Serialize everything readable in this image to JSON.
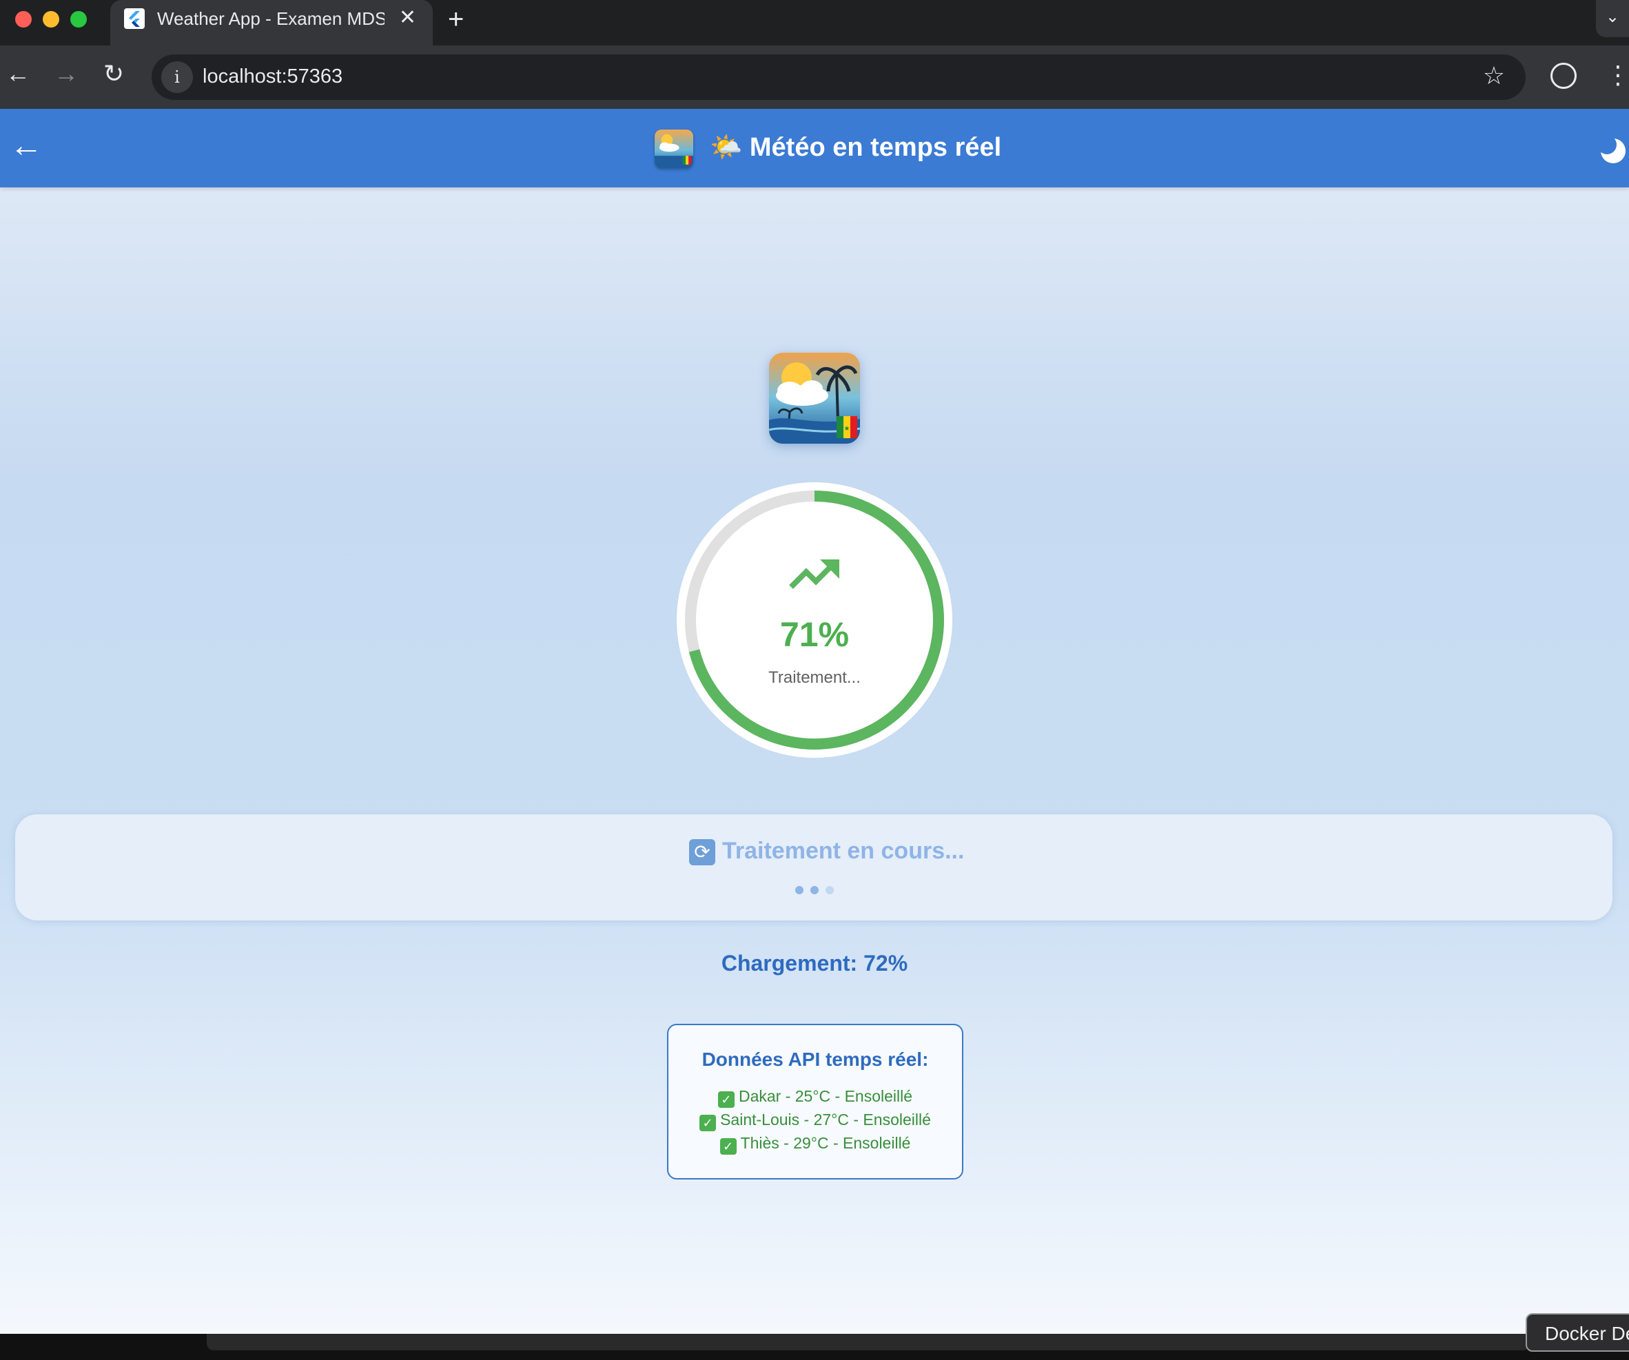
{
  "browser": {
    "tab_title": "Weather App - Examen MDSIA",
    "url": "localhost:57363"
  },
  "appbar": {
    "title": "🌤️ Météo en temps réel"
  },
  "progress": {
    "ring_fraction": 0.71,
    "percent_label": "71%",
    "sub_label": "Traitement..."
  },
  "status": {
    "emoji": "🔄",
    "text": "Traitement en cours..."
  },
  "loading_text": "Chargement: 72%",
  "api": {
    "title": "Données API temps réel:",
    "items": [
      "Dakar - 25°C - Ensoleillé",
      "Saint-Louis - 27°C - Ensoleillé",
      "Thiès - 29°C - Ensoleillé"
    ]
  },
  "dock": {
    "tooltip": "Docker Desktop"
  },
  "colors": {
    "appbar": "#3b7bd4",
    "progress": "#4caf50",
    "accent_text": "#2e6bbf"
  }
}
